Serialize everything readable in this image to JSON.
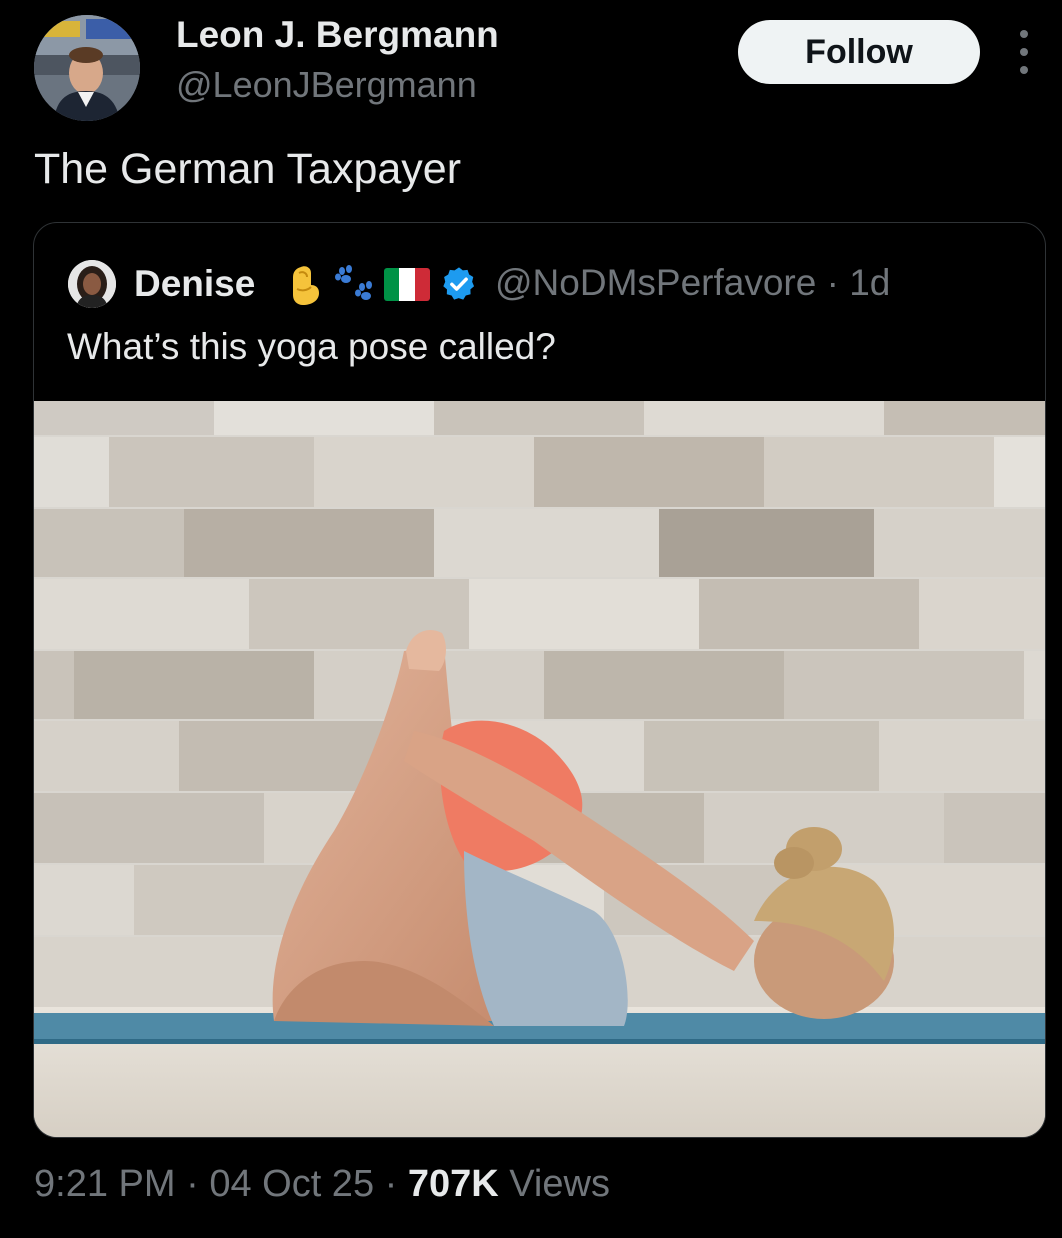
{
  "author": {
    "name": "Leon J. Bergmann",
    "handle": "@LeonJBergmann"
  },
  "follow_label": "Follow",
  "tweet_text": "The German Taxpayer",
  "quoted": {
    "name": "Denise",
    "handle_time": "@NoDMsPerfavore · 1d",
    "text": "What’s this yoga pose called?",
    "emojis": [
      "pinched-fingers-icon",
      "paw-prints-icon",
      "italy-flag-icon"
    ],
    "verified": true
  },
  "meta": {
    "time": "9:21 PM",
    "sep1": " · ",
    "date": "04 Oct 25",
    "sep2": " · ",
    "views_count": "707K",
    "views_label": " Views"
  },
  "colors": {
    "background": "#000000",
    "primary_text": "#e7e9ea",
    "secondary_text": "#71767b",
    "follow_bg": "#eff3f4",
    "verified_blue": "#1d9bf0"
  }
}
